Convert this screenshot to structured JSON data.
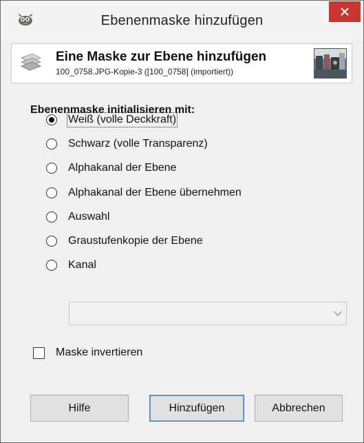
{
  "window": {
    "title": "Ebenenmaske hinzufügen"
  },
  "header": {
    "title": "Eine Maske zur Ebene hinzufügen",
    "subtitle": "100_0758.JPG-Kopie-3 ([100_0758] (importiert))"
  },
  "init": {
    "label": "Ebenenmaske initialisieren mit:",
    "options": [
      {
        "label": "Weiß (volle Deckkraft)",
        "checked": true
      },
      {
        "label": "Schwarz (volle Transparenz)",
        "checked": false
      },
      {
        "label": "Alphakanal der Ebene",
        "checked": false
      },
      {
        "label": "Alphakanal der Ebene übernehmen",
        "checked": false
      },
      {
        "label": "Auswahl",
        "checked": false
      },
      {
        "label": "Graustufenkopie der Ebene",
        "checked": false
      },
      {
        "label": "Kanal",
        "checked": false
      }
    ],
    "channel_value": ""
  },
  "invert": {
    "label": "Maske invertieren",
    "checked": false
  },
  "buttons": {
    "help": "Hilfe",
    "add": "Hinzufügen",
    "cancel": "Abbrechen"
  },
  "icons": {
    "app": "gimp-wilber-icon",
    "close": "close-icon",
    "header": "layer-mask-icon",
    "combo_arrow": "chevron-down-icon"
  },
  "colors": {
    "close_bg": "#c7372f",
    "default_button_border": "#3b7bd0"
  }
}
